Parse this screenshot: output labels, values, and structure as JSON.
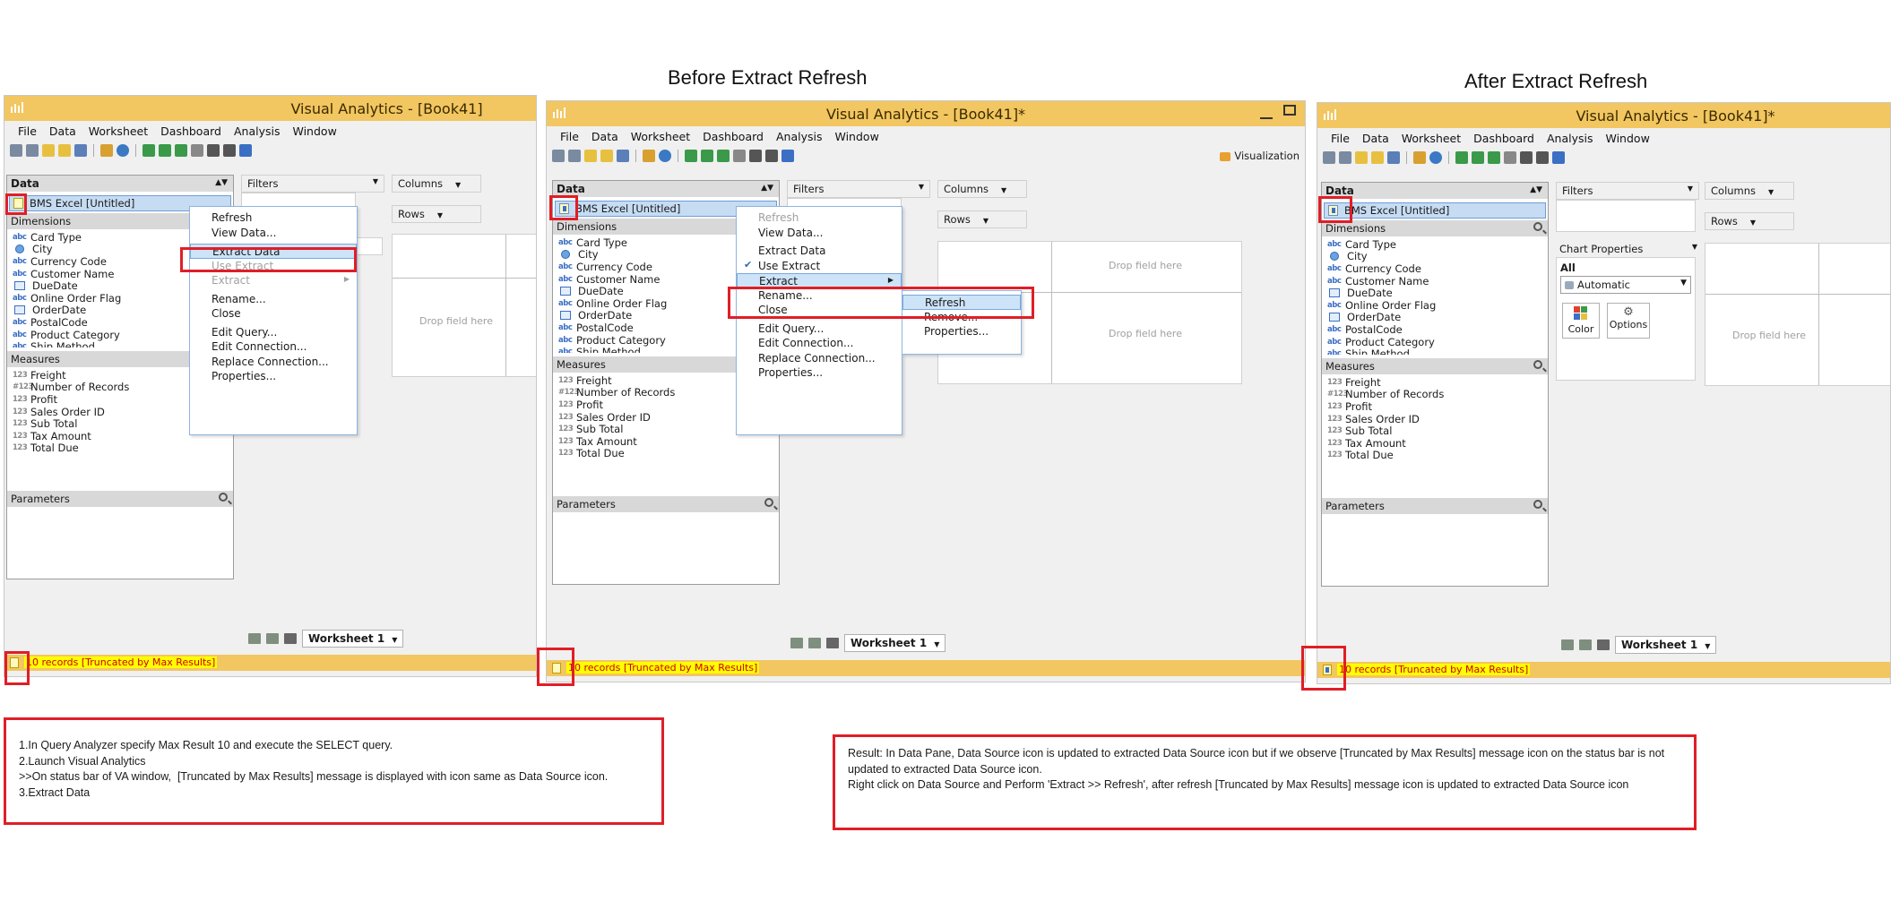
{
  "headings": {
    "before": "Before Extract Refresh",
    "after": "After Extract Refresh"
  },
  "windows": [
    {
      "title": "Visual Analytics - [Book41]",
      "menus": [
        "File",
        "Data",
        "Worksheet",
        "Dashboard",
        "Analysis",
        "Window"
      ],
      "data_label": "Data",
      "data_source": "BMS Excel [Untitled]",
      "dimensions_label": "Dimensions",
      "measures_label": "Measures",
      "parameters_label": "Parameters",
      "filters_label": "Filters",
      "columns_label": "Columns",
      "rows_label": "Rows",
      "drop_field": "Drop field here",
      "worksheet_tab": "Worksheet 1",
      "status_text": "10 records [Truncated by Max Results]"
    },
    {
      "title": "Visual Analytics - [Book41]*",
      "menus": [
        "File",
        "Data",
        "Worksheet",
        "Dashboard",
        "Analysis",
        "Window"
      ],
      "data_label": "Data",
      "data_source": "BMS Excel [Untitled]",
      "dimensions_label": "Dimensions",
      "measures_label": "Measures",
      "parameters_label": "Parameters",
      "filters_label": "Filters",
      "columns_label": "Columns",
      "rows_label": "Rows",
      "drop_field": "Drop field here",
      "worksheet_tab": "Worksheet 1",
      "status_text": "10 records [Truncated by Max Results]",
      "visualization_label": "Visualization"
    },
    {
      "title": "Visual Analytics - [Book41]*",
      "menus": [
        "File",
        "Data",
        "Worksheet",
        "Dashboard",
        "Analysis",
        "Window"
      ],
      "data_label": "Data",
      "data_source": "BMS Excel [Untitled]",
      "dimensions_label": "Dimensions",
      "measures_label": "Measures",
      "parameters_label": "Parameters",
      "filters_label": "Filters",
      "columns_label": "Columns",
      "rows_label": "Rows",
      "drop_field": "Drop field here",
      "worksheet_tab": "Worksheet 1",
      "status_text": "10 records [Truncated by Max Results]",
      "chart_properties": "Chart Properties",
      "all_label": "All",
      "automatic": "Automatic",
      "color_btn": "Color",
      "options_btn": "Options"
    }
  ],
  "dimensions": [
    {
      "name": "Card Type",
      "type": "abc"
    },
    {
      "name": "City",
      "type": "geo"
    },
    {
      "name": "Currency Code",
      "type": "abc"
    },
    {
      "name": "Customer Name",
      "type": "abc"
    },
    {
      "name": "DueDate",
      "type": "date"
    },
    {
      "name": "Online Order Flag",
      "type": "abc"
    },
    {
      "name": "OrderDate",
      "type": "date"
    },
    {
      "name": "PostalCode",
      "type": "abc"
    },
    {
      "name": "Product Category",
      "type": "abc"
    },
    {
      "name": "Ship Method",
      "type": "abc"
    }
  ],
  "measures": [
    {
      "name": "Freight",
      "type": "123"
    },
    {
      "name": "Number of Records",
      "type": "#123"
    },
    {
      "name": "Profit",
      "type": "123"
    },
    {
      "name": "Sales Order ID",
      "type": "123"
    },
    {
      "name": "Sub Total",
      "type": "123"
    },
    {
      "name": "Tax Amount",
      "type": "123"
    },
    {
      "name": "Total Due",
      "type": "123"
    }
  ],
  "context_menu_1": {
    "items": [
      "Refresh",
      "View Data...",
      "Extract Data",
      "Use Extract",
      "Extract",
      "Rename...",
      "Close",
      "Edit Query...",
      "Edit Connection...",
      "Replace Connection...",
      "Properties..."
    ]
  },
  "context_menu_2": {
    "items": [
      "Refresh",
      "View Data...",
      "Extract Data",
      "Use Extract",
      "Extract",
      "Rename...",
      "Close",
      "Edit Query...",
      "Edit Connection...",
      "Replace Connection...",
      "Properties..."
    ],
    "submenu": [
      "Refresh",
      "Remove...",
      "Properties..."
    ]
  },
  "notes": {
    "left": "1.In Query Analyzer specify Max Result 10 and execute the SELECT query.\n2.Launch Visual Analytics\n>>On status bar of VA window,  [Truncated by Max Results] message is displayed with icon same as Data Source icon.\n3.Extract Data",
    "right": "Result: In Data Pane, Data Source icon is updated to extracted Data Source icon but if we observe [Truncated by Max Results] message icon on the status bar is not updated to extracted Data Source icon.\nRight click on Data Source and Perform 'Extract >> Refresh', after refresh [Truncated by Max Results] message icon is updated to extracted Data Source icon"
  },
  "colors": {
    "titlebar": "#f2c660",
    "highlight_box": "#e01e26",
    "selection": "#c6dcf3",
    "status_text": "#cc0000"
  }
}
